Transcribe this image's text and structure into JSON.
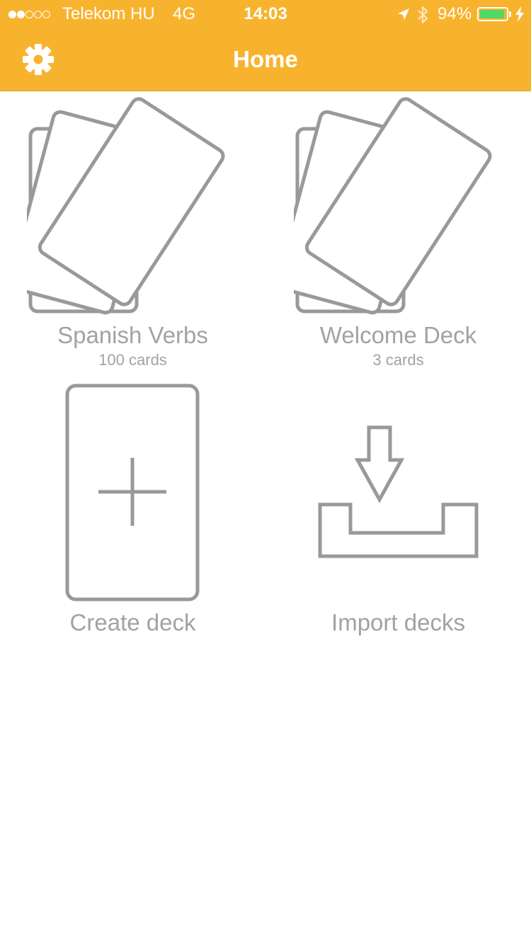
{
  "status_bar": {
    "carrier": "Telekom HU",
    "network": "4G",
    "time": "14:03",
    "battery_percent": "94%",
    "battery_level": 0.94,
    "signal_strength": 2,
    "signal_max": 5,
    "icons": [
      "location-arrow-icon",
      "bluetooth-icon",
      "battery-icon",
      "charging-bolt-icon"
    ]
  },
  "nav": {
    "title": "Home",
    "left_icon": "gear-icon"
  },
  "theme": {
    "accent": "#F8B32E",
    "icon_gray": "#999999",
    "text_gray": "#A2A2A2",
    "battery_green": "#4CD964"
  },
  "decks": [
    {
      "name": "Spanish Verbs",
      "count": "100 cards",
      "icon": "card-stack-icon"
    },
    {
      "name": "Welcome Deck",
      "count": "3 cards",
      "icon": "card-stack-icon"
    }
  ],
  "actions": {
    "create": {
      "label": "Create deck",
      "icon": "add-card-icon"
    },
    "import": {
      "label": "Import decks",
      "icon": "import-tray-icon"
    }
  }
}
